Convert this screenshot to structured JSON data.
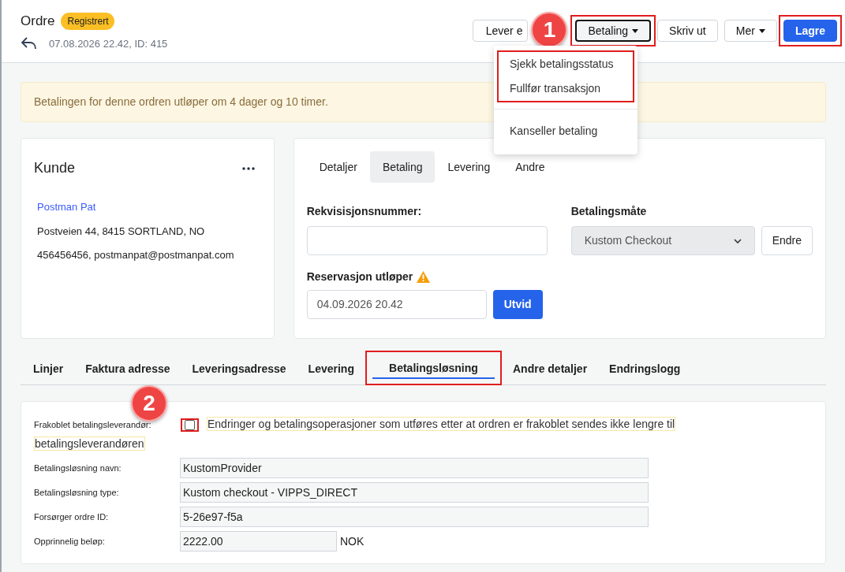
{
  "header": {
    "title": "Ordre",
    "status": "Registrert",
    "meta": "07.08.2026 22.42, ID: 415"
  },
  "actions": [
    {
      "label": "Lever e",
      "kind": "plain",
      "highlighted": false,
      "dropdown": false
    },
    {
      "label": "Betaling",
      "kind": "focused",
      "highlighted": true,
      "dropdown": true
    },
    {
      "label": "Skriv ut",
      "kind": "plain",
      "highlighted": false,
      "dropdown": false
    },
    {
      "label": "Mer",
      "kind": "plain",
      "highlighted": false,
      "dropdown": true
    },
    {
      "label": "Lagre",
      "kind": "primary",
      "highlighted": true,
      "dropdown": false
    }
  ],
  "menu": {
    "groups": [
      {
        "highlighted": true,
        "items": [
          "Sjekk betalingsstatus",
          "Fullfør transaksjon"
        ]
      },
      {
        "highlighted": false,
        "items": [
          "Kanseller betaling"
        ]
      }
    ]
  },
  "callouts": [
    {
      "number": "1"
    },
    {
      "number": "2"
    }
  ],
  "alert": "Betalingen for denne ordren utløper om 4 dager og 10 timer.",
  "customer": {
    "title": "Kunde",
    "name": "Postman Pat",
    "address": "Postveien 44, 8415 SORTLAND, NO",
    "contact": "456456456, postmanpat@postmanpat.com"
  },
  "detail_tabs": [
    {
      "label": "Detaljer",
      "selected": false
    },
    {
      "label": "Betaling",
      "selected": true
    },
    {
      "label": "Levering",
      "selected": false
    },
    {
      "label": "Andre",
      "selected": false
    }
  ],
  "payment": {
    "requisition_label": "Rekvisisjonsnummer:",
    "method_label": "Betalingsmåte",
    "method_value": "Kustom Checkout",
    "change_button": "Endre",
    "reservation_label": "Reservasjon utløper",
    "reservation_value": "04.09.2026 20.42",
    "extend_button": "Utvid"
  },
  "section_tabs": [
    {
      "label": "Linjer",
      "selected": false,
      "highlighted": false
    },
    {
      "label": "Faktura adresse",
      "selected": false,
      "highlighted": false
    },
    {
      "label": "Leveringsadresse",
      "selected": false,
      "highlighted": false
    },
    {
      "label": "Levering",
      "selected": false,
      "highlighted": false
    },
    {
      "label": "Betalingsløsning",
      "selected": true,
      "highlighted": true
    },
    {
      "label": "Andre detaljer",
      "selected": false,
      "highlighted": false
    },
    {
      "label": "Endringslogg",
      "selected": false,
      "highlighted": false
    }
  ],
  "solution": {
    "disconnected_label": "Frakoblet betalingsleverandør:",
    "disconnected_checked": false,
    "disconnected_note": "Endringer og betalingsoperasjoner som utføres etter at ordren er frakoblet sendes ikke lengre til betalingsleverandøren",
    "fields": [
      {
        "label": "Betalingsløsning navn:",
        "value": "KustomProvider",
        "kind": "wide"
      },
      {
        "label": "Betalingsløsning type:",
        "value": "Kustom checkout - VIPPS_DIRECT",
        "kind": "wide"
      },
      {
        "label": "Forsørger ordre ID:",
        "value": "5-26e97-f5a",
        "kind": "wide"
      },
      {
        "label": "Opprinnelig beløp:",
        "value": "2222.00",
        "kind": "amount",
        "unit": "NOK"
      }
    ]
  }
}
